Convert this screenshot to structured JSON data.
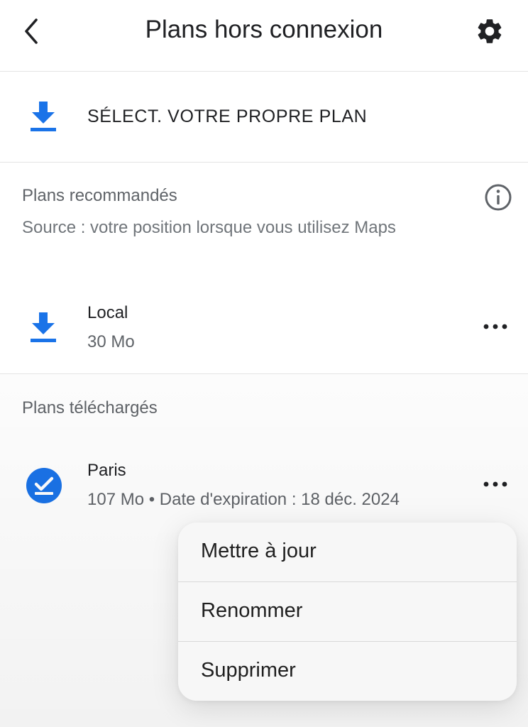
{
  "header": {
    "title": "Plans hors connexion",
    "back_icon": "chevron-left-icon",
    "settings_icon": "gear-icon"
  },
  "select_own_map": {
    "label": "SÉLECT. VOTRE PROPRE PLAN",
    "icon": "download-icon"
  },
  "recommended": {
    "heading": "Plans recommandés",
    "source": "Source : votre position lorsque vous utilisez Maps",
    "info_icon": "info-icon",
    "items": [
      {
        "name": "Local",
        "meta": "30 Mo",
        "icon": "download-icon",
        "more_icon": "more-horizontal-icon"
      }
    ]
  },
  "downloaded": {
    "heading": "Plans téléchargés",
    "items": [
      {
        "name": "Paris",
        "meta": "107 Mo • Date d'expiration : 18 déc. 2024",
        "icon": "downloaded-check-icon",
        "more_icon": "more-horizontal-icon"
      }
    ]
  },
  "context_menu": {
    "items": [
      {
        "label": "Mettre à jour"
      },
      {
        "label": "Renommer"
      },
      {
        "label": "Supprimer"
      }
    ]
  },
  "colors": {
    "accent": "#1a73e8",
    "text_primary": "#202124",
    "text_secondary": "#5f6368",
    "divider": "#e4e4e4"
  }
}
